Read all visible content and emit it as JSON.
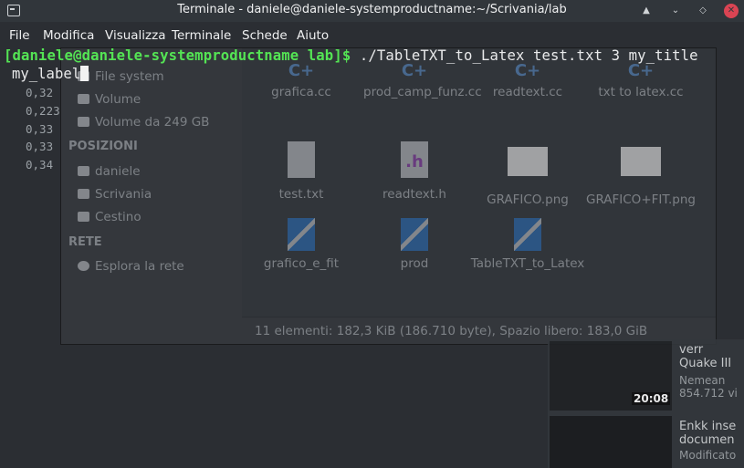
{
  "window": {
    "title": "Terminale - daniele@daniele-systemproductname:~/Scrivania/lab"
  },
  "menu": [
    "File",
    "Modifica",
    "Visualizza",
    "Terminale",
    "Schede",
    "Aiuto"
  ],
  "prompt": {
    "user_host_path": "[daniele@daniele-systemproductname lab]$",
    "command": " ./TableTXT_to_Latex test.txt 3 my_title",
    "continuation": "my_label"
  },
  "file_manager": {
    "sidebar": {
      "devices": [
        {
          "label": "File system",
          "icon": "drive-icon"
        },
        {
          "label": "Volume",
          "icon": "drive-icon"
        },
        {
          "label": "Volume da 249 GB",
          "icon": "drive-icon"
        }
      ],
      "places_header": "POSIZIONI",
      "places": [
        {
          "label": "daniele",
          "icon": "home-icon"
        },
        {
          "label": "Scrivania",
          "icon": "desktop-icon"
        },
        {
          "label": "Cestino",
          "icon": "trash-icon"
        }
      ],
      "network_header": "RETE",
      "network": [
        {
          "label": "Esplora la rete",
          "icon": "globe-icon"
        }
      ]
    },
    "files": [
      {
        "name": "grafica.cc",
        "icon": "cpp-file-icon"
      },
      {
        "name": "prod_camp_funz.cc",
        "icon": "cpp-file-icon"
      },
      {
        "name": "readtext.cc",
        "icon": "cpp-file-icon"
      },
      {
        "name": "txt to latex.cc",
        "icon": "cpp-file-icon"
      },
      {
        "name": "test.txt",
        "icon": "text-file-icon"
      },
      {
        "name": "readtext.h",
        "icon": "header-file-icon"
      },
      {
        "name": "GRAFICO.png",
        "icon": "image-file-icon"
      },
      {
        "name": "GRAFICO+FIT.png",
        "icon": "image-file-icon"
      },
      {
        "name": "grafico_e_fit",
        "icon": "executable-icon"
      },
      {
        "name": "prod",
        "icon": "executable-icon"
      },
      {
        "name": "TableTXT_to_Latex",
        "icon": "executable-icon"
      }
    ],
    "status": "11 elementi: 182,3 KiB (186.710 byte), Spazio libero: 183,0 GiB"
  },
  "background": {
    "left_values": [
      "0,32",
      "0,223",
      "0,33",
      "0,33",
      "0,34"
    ],
    "videos": [
      {
        "title": "Quake III",
        "title_prefix": "verr",
        "channel": "Nemean",
        "views": "854.712 vi",
        "duration": "20:08"
      },
      {
        "title": "Enkk inse",
        "title2": "documen",
        "channel": "Modificato"
      }
    ]
  },
  "colors": {
    "prompt_green": "#54e454",
    "close_red": "#da4453",
    "titlebar": "#31363b"
  }
}
